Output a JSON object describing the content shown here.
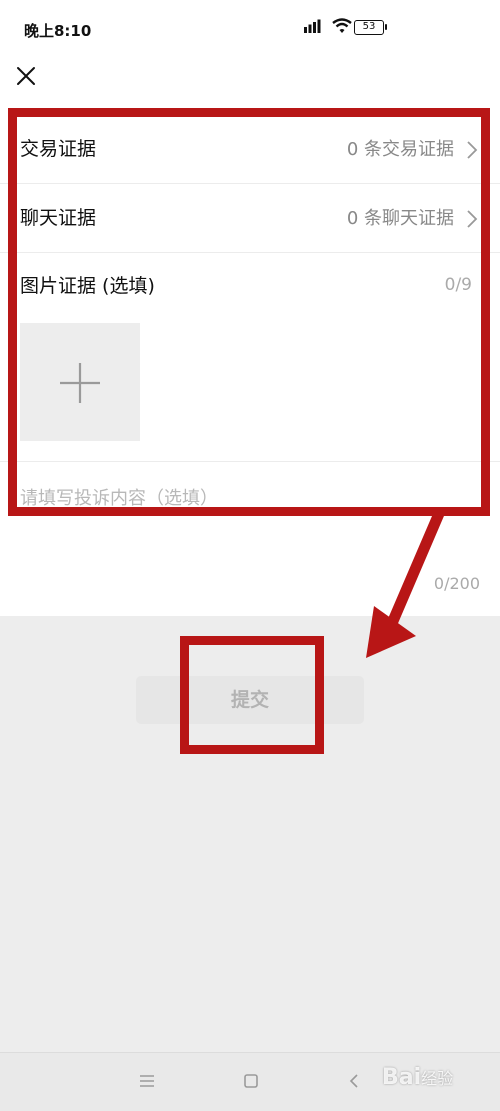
{
  "status_bar": {
    "time": "晚上8:10",
    "battery": "53"
  },
  "header": {
    "close_icon": "close-icon"
  },
  "form": {
    "rows": [
      {
        "label": "交易证据",
        "value": "0 条交易证据"
      },
      {
        "label": "聊天证据",
        "value": "0 条聊天证据"
      }
    ],
    "image_section": {
      "label": "图片证据 (选填)",
      "count": "0/9"
    },
    "complaint": {
      "placeholder": "请填写投诉内容（选填）",
      "count": "0/200"
    }
  },
  "actions": {
    "submit_label": "提交"
  },
  "watermark": {
    "brand": "Bai",
    "suffix": "经验"
  },
  "colors": {
    "annotation": "#b81616",
    "page_bg": "#ededed",
    "card_bg": "#ffffff"
  }
}
